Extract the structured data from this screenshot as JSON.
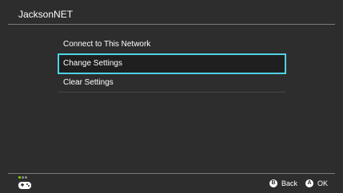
{
  "header": {
    "title": "JacksonNET"
  },
  "menu": {
    "items": [
      {
        "label": "Connect to This Network"
      },
      {
        "label": "Change Settings"
      },
      {
        "label": "Clear Settings"
      }
    ]
  },
  "footer": {
    "back_glyph": "B",
    "back_label": "Back",
    "ok_glyph": "A",
    "ok_label": "OK"
  },
  "colors": {
    "background": "#2d2d2d",
    "accent": "#4fd2e4",
    "battery_green": "#8fd400"
  }
}
